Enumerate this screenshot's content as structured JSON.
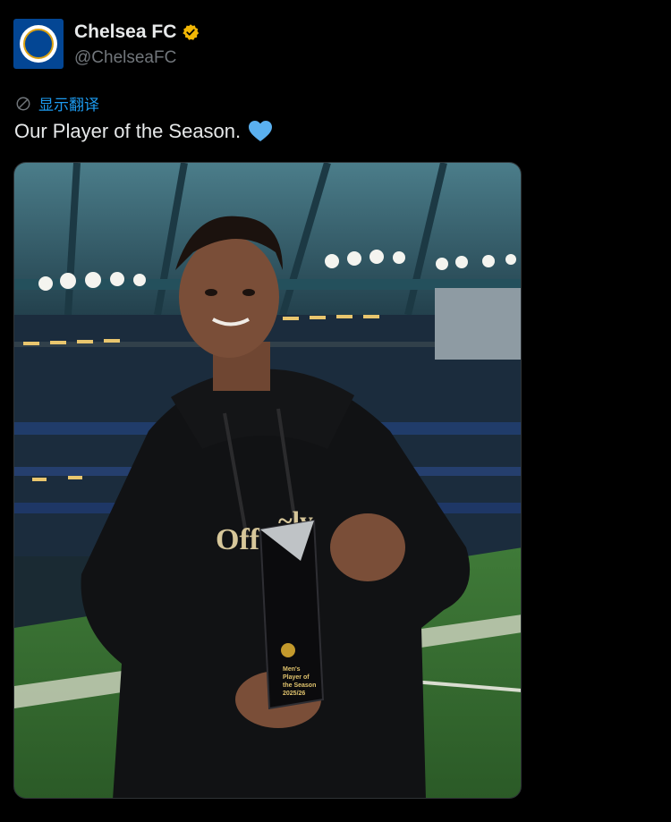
{
  "post": {
    "author_name": "Chelsea FC",
    "author_handle": "@ChelseaFC",
    "translate_label": "显示翻译",
    "text": "Our Player of the Season.",
    "emoji_icon": "blue-heart-icon"
  },
  "colors": {
    "accent": "#1d9bf0",
    "verified": "#f2b705",
    "chelsea_blue": "#034694",
    "heart": "#5ab0f0"
  }
}
